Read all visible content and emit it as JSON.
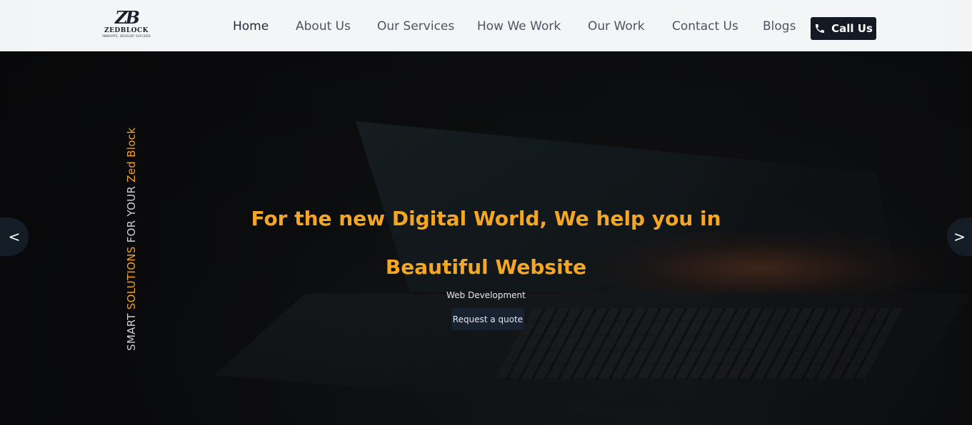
{
  "brand": {
    "mark": "ZB",
    "name": "ZEDBLOCK",
    "tagline": "INNOVATE. DEVELOP. SUCCEED"
  },
  "nav": {
    "items": [
      {
        "label": "Home",
        "active": true
      },
      {
        "label": "About Us",
        "active": false
      },
      {
        "label": "Our Services",
        "active": false
      },
      {
        "label": "How We Work",
        "active": false
      },
      {
        "label": "Our Work",
        "active": false
      },
      {
        "label": "Contact Us",
        "active": false
      },
      {
        "label": "Blogs",
        "active": false
      }
    ],
    "call_label": "Call Us",
    "call_icon": "phone-icon"
  },
  "hero": {
    "vertical": {
      "part1": "SMART ",
      "part2": "SOLUTIONS",
      "part3": " FOR YOUR ",
      "part4": "Zed Block"
    },
    "headline_line1": "For the new Digital World, We help you in",
    "headline_line2": "Beautiful Website",
    "subtitle": "Web Development",
    "cta_label": "Request a quote",
    "prev_label": "<",
    "next_label": ">"
  },
  "colors": {
    "accent": "#f5a623",
    "nav_bg": "#f3f4f6",
    "dark_button": "#141923"
  }
}
